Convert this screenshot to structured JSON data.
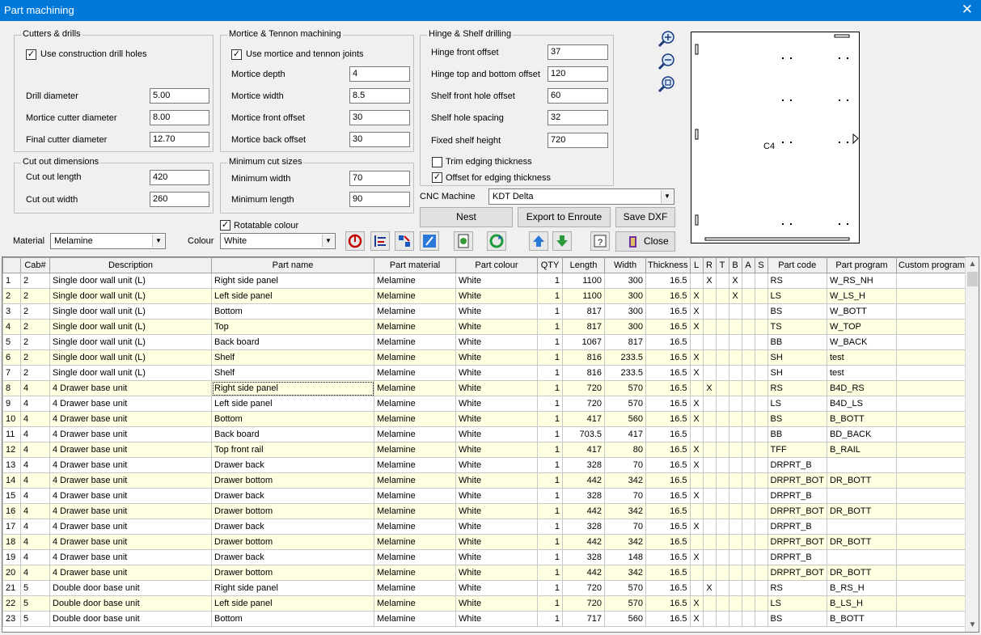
{
  "window": {
    "title": "Part machining",
    "close_glyph": "✕"
  },
  "cutters": {
    "legend": "Cutters & drills",
    "use_drill_label": "Use construction drill holes",
    "drill_diameter_label": "Drill diameter",
    "drill_diameter": "5.00",
    "mortice_cutter_label": "Mortice cutter diameter",
    "mortice_cutter": "8.00",
    "final_cutter_label": "Final cutter diameter",
    "final_cutter": "12.70"
  },
  "mortice": {
    "legend": "Mortice & Tennon machining",
    "use_joints_label": "Use mortice and tennon joints",
    "depth_label": "Mortice depth",
    "depth": "4",
    "width_label": "Mortice width",
    "width": "8.5",
    "front_offset_label": "Mortice front offset",
    "front_offset": "30",
    "back_offset_label": "Mortice back offset",
    "back_offset": "30"
  },
  "hinge": {
    "legend": "Hinge & Shelf drilling",
    "front_offset_label": "Hinge front offset",
    "front_offset": "37",
    "top_bottom_label": "Hinge top and bottom offset",
    "top_bottom": "120",
    "shelf_front_label": "Shelf front hole offset",
    "shelf_front": "60",
    "spacing_label": "Shelf hole spacing",
    "spacing": "32",
    "fixed_height_label": "Fixed shelf height",
    "fixed_height": "720",
    "trim_label": "Trim edging thickness",
    "offset_label": "Offset for edging thickness"
  },
  "cutout": {
    "legend": "Cut out dimensions",
    "length_label": "Cut out length",
    "length": "420",
    "width_label": "Cut out width",
    "width": "260"
  },
  "mincut": {
    "legend": "Minimum cut sizes",
    "width_label": "Minimum width",
    "width": "70",
    "length_label": "Minimum length",
    "length": "90"
  },
  "cnc": {
    "label": "CNC Machine",
    "value": "KDT Delta"
  },
  "buttons": {
    "nest": "Nest",
    "export": "Export to Enroute",
    "save_dxf": "Save DXF",
    "close": "Close"
  },
  "material": {
    "label": "Material",
    "value": "Melamine"
  },
  "colour": {
    "label": "Colour",
    "value": "White",
    "rotatable_label": "Rotatable colour"
  },
  "preview": {
    "label": "C4"
  },
  "checkbox_mark": "✓",
  "grid": {
    "columns": [
      "Cab#",
      "Description",
      "Part name",
      "Part material",
      "Part colour",
      "QTY",
      "Length",
      "Width",
      "Thickness",
      "L",
      "R",
      "T",
      "B",
      "A",
      "S",
      "Part code",
      "Part program",
      "Custom program"
    ],
    "rows": [
      [
        "1",
        "2",
        "Single door wall unit (L)",
        "Right side panel",
        "Melamine",
        "White",
        "1",
        "1100",
        "300",
        "16.5",
        "",
        "X",
        "",
        "X",
        "",
        "",
        "RS",
        "W_RS_NH",
        ""
      ],
      [
        "2",
        "2",
        "Single door wall unit (L)",
        "Left side panel",
        "Melamine",
        "White",
        "1",
        "1100",
        "300",
        "16.5",
        "X",
        "",
        "",
        "X",
        "",
        "",
        "LS",
        "W_LS_H",
        ""
      ],
      [
        "3",
        "2",
        "Single door wall unit (L)",
        "Bottom",
        "Melamine",
        "White",
        "1",
        "817",
        "300",
        "16.5",
        "X",
        "",
        "",
        "",
        "",
        "",
        "BS",
        "W_BOTT",
        ""
      ],
      [
        "4",
        "2",
        "Single door wall unit (L)",
        "Top",
        "Melamine",
        "White",
        "1",
        "817",
        "300",
        "16.5",
        "X",
        "",
        "",
        "",
        "",
        "",
        "TS",
        "W_TOP",
        ""
      ],
      [
        "5",
        "2",
        "Single door wall unit (L)",
        "Back board",
        "Melamine",
        "White",
        "1",
        "1067",
        "817",
        "16.5",
        "",
        "",
        "",
        "",
        "",
        "",
        "BB",
        "W_BACK",
        ""
      ],
      [
        "6",
        "2",
        "Single door wall unit (L)",
        "Shelf",
        "Melamine",
        "White",
        "1",
        "816",
        "233.5",
        "16.5",
        "X",
        "",
        "",
        "",
        "",
        "",
        "SH",
        "test",
        ""
      ],
      [
        "7",
        "2",
        "Single door wall unit (L)",
        "Shelf",
        "Melamine",
        "White",
        "1",
        "816",
        "233.5",
        "16.5",
        "X",
        "",
        "",
        "",
        "",
        "",
        "SH",
        "test",
        ""
      ],
      [
        "8",
        "4",
        "4 Drawer base unit",
        "Right side panel",
        "Melamine",
        "White",
        "1",
        "720",
        "570",
        "16.5",
        "",
        "X",
        "",
        "",
        "",
        "",
        "RS",
        "B4D_RS",
        ""
      ],
      [
        "9",
        "4",
        "4 Drawer base unit",
        "Left side panel",
        "Melamine",
        "White",
        "1",
        "720",
        "570",
        "16.5",
        "X",
        "",
        "",
        "",
        "",
        "",
        "LS",
        "B4D_LS",
        ""
      ],
      [
        "10",
        "4",
        "4 Drawer base unit",
        "Bottom",
        "Melamine",
        "White",
        "1",
        "417",
        "560",
        "16.5",
        "X",
        "",
        "",
        "",
        "",
        "",
        "BS",
        "B_BOTT",
        ""
      ],
      [
        "11",
        "4",
        "4 Drawer base unit",
        "Back board",
        "Melamine",
        "White",
        "1",
        "703.5",
        "417",
        "16.5",
        "",
        "",
        "",
        "",
        "",
        "",
        "BB",
        "BD_BACK",
        ""
      ],
      [
        "12",
        "4",
        "4 Drawer base unit",
        "Top front rail",
        "Melamine",
        "White",
        "1",
        "417",
        "80",
        "16.5",
        "X",
        "",
        "",
        "",
        "",
        "",
        "TFF",
        "B_RAIL",
        ""
      ],
      [
        "13",
        "4",
        "4 Drawer base unit",
        "Drawer back",
        "Melamine",
        "White",
        "1",
        "328",
        "70",
        "16.5",
        "X",
        "",
        "",
        "",
        "",
        "",
        "DRPRT_B",
        "",
        ""
      ],
      [
        "14",
        "4",
        "4 Drawer base unit",
        "Drawer bottom",
        "Melamine",
        "White",
        "1",
        "442",
        "342",
        "16.5",
        "",
        "",
        "",
        "",
        "",
        "",
        "DRPRT_BOT",
        "DR_BOTT",
        ""
      ],
      [
        "15",
        "4",
        "4 Drawer base unit",
        "Drawer back",
        "Melamine",
        "White",
        "1",
        "328",
        "70",
        "16.5",
        "X",
        "",
        "",
        "",
        "",
        "",
        "DRPRT_B",
        "",
        ""
      ],
      [
        "16",
        "4",
        "4 Drawer base unit",
        "Drawer bottom",
        "Melamine",
        "White",
        "1",
        "442",
        "342",
        "16.5",
        "",
        "",
        "",
        "",
        "",
        "",
        "DRPRT_BOT",
        "DR_BOTT",
        ""
      ],
      [
        "17",
        "4",
        "4 Drawer base unit",
        "Drawer back",
        "Melamine",
        "White",
        "1",
        "328",
        "70",
        "16.5",
        "X",
        "",
        "",
        "",
        "",
        "",
        "DRPRT_B",
        "",
        ""
      ],
      [
        "18",
        "4",
        "4 Drawer base unit",
        "Drawer bottom",
        "Melamine",
        "White",
        "1",
        "442",
        "342",
        "16.5",
        "",
        "",
        "",
        "",
        "",
        "",
        "DRPRT_BOT",
        "DR_BOTT",
        ""
      ],
      [
        "19",
        "4",
        "4 Drawer base unit",
        "Drawer back",
        "Melamine",
        "White",
        "1",
        "328",
        "148",
        "16.5",
        "X",
        "",
        "",
        "",
        "",
        "",
        "DRPRT_B",
        "",
        ""
      ],
      [
        "20",
        "4",
        "4 Drawer base unit",
        "Drawer bottom",
        "Melamine",
        "White",
        "1",
        "442",
        "342",
        "16.5",
        "",
        "",
        "",
        "",
        "",
        "",
        "DRPRT_BOT",
        "DR_BOTT",
        ""
      ],
      [
        "21",
        "5",
        "Double door base unit",
        "Right side panel",
        "Melamine",
        "White",
        "1",
        "720",
        "570",
        "16.5",
        "",
        "X",
        "",
        "",
        "",
        "",
        "RS",
        "B_RS_H",
        ""
      ],
      [
        "22",
        "5",
        "Double door base unit",
        "Left side panel",
        "Melamine",
        "White",
        "1",
        "720",
        "570",
        "16.5",
        "X",
        "",
        "",
        "",
        "",
        "",
        "LS",
        "B_LS_H",
        ""
      ],
      [
        "23",
        "5",
        "Double door base unit",
        "Bottom",
        "Melamine",
        "White",
        "1",
        "717",
        "560",
        "16.5",
        "X",
        "",
        "",
        "",
        "",
        "",
        "BS",
        "B_BOTT",
        ""
      ]
    ]
  }
}
